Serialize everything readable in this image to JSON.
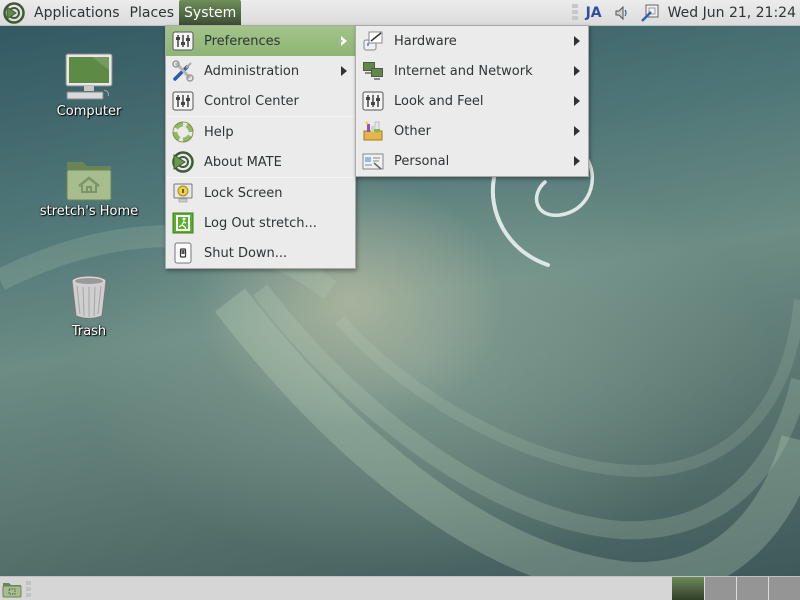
{
  "top_panel": {
    "menus": [
      {
        "label": "Applications",
        "icon": "mate-logo-icon"
      },
      {
        "label": "Places"
      },
      {
        "label": "System",
        "active": true
      }
    ],
    "tray": {
      "keyboard_layout": "JA",
      "volume_icon": "speaker-icon",
      "notes_icon": "sticky-notes-icon",
      "clock": "Wed Jun 21, 21:24"
    }
  },
  "desktop": {
    "icons": [
      {
        "label": "Computer",
        "icon": "computer-icon"
      },
      {
        "label": "stretch's Home",
        "icon": "home-folder-icon"
      },
      {
        "label": "Trash",
        "icon": "trash-icon"
      }
    ]
  },
  "system_menu": {
    "items": [
      {
        "label": "Preferences",
        "icon": "preferences-icon",
        "submenu": true,
        "highlighted": true
      },
      {
        "label": "Administration",
        "icon": "administration-icon",
        "submenu": true
      },
      {
        "label": "Control Center",
        "icon": "control-center-icon"
      },
      {
        "label": "Help",
        "icon": "help-icon"
      },
      {
        "label": "About MATE",
        "icon": "mate-logo-icon"
      },
      {
        "label": "Lock Screen",
        "icon": "lock-screen-icon"
      },
      {
        "label": "Log Out stretch...",
        "icon": "log-out-icon"
      },
      {
        "label": "Shut Down...",
        "icon": "shut-down-icon"
      }
    ]
  },
  "preferences_submenu": {
    "items": [
      {
        "label": "Hardware",
        "icon": "hardware-icon",
        "submenu": true
      },
      {
        "label": "Internet and Network",
        "icon": "network-icon",
        "submenu": true
      },
      {
        "label": "Look and Feel",
        "icon": "look-and-feel-icon",
        "submenu": true
      },
      {
        "label": "Other",
        "icon": "other-icon",
        "submenu": true
      },
      {
        "label": "Personal",
        "icon": "personal-icon",
        "submenu": true
      }
    ]
  },
  "bottom_panel": {
    "show_desktop_icon": "show-desktop-icon",
    "workspaces": {
      "count": 4,
      "active": 1
    }
  },
  "colors": {
    "highlight": "#9bbf82",
    "panel_active": "#4e6342",
    "menu_bg": "#ebebeb"
  }
}
